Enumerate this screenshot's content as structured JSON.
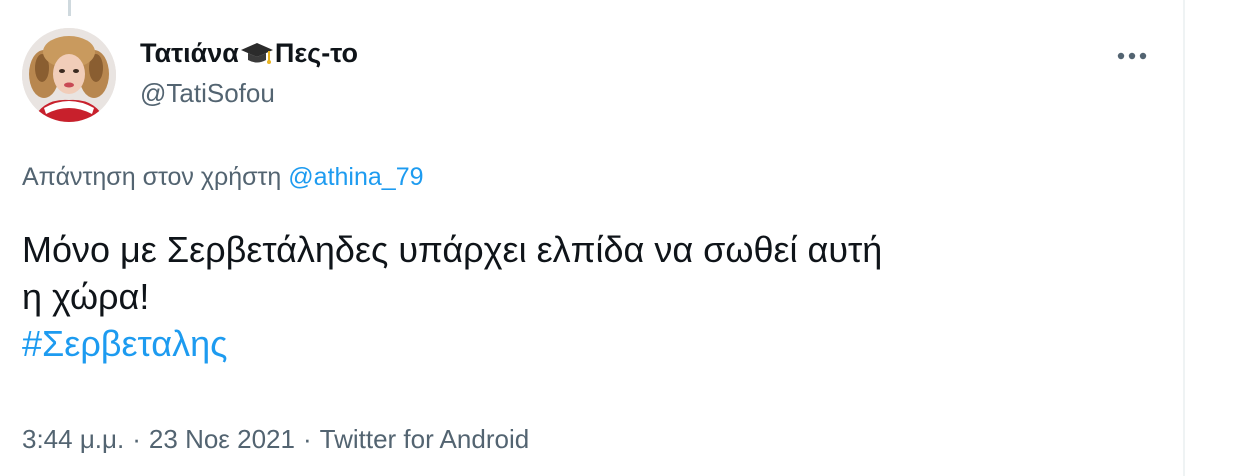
{
  "tweet": {
    "author": {
      "name_first": "Τατιάνα",
      "name_icon": "graduation-cap-emoji",
      "name_second": "Πες-το",
      "handle": "@TatiSofou",
      "avatar": "profile-photo"
    },
    "more_icon": "ellipsis-icon",
    "reply": {
      "prefix": "Απάντηση στον χρήστη",
      "mention": "@athina_79"
    },
    "text_line1": "Μόνο με Σερβετάληδες υπάρχει ελπίδα να σωθεί αυτή",
    "text_line2": "η χώρα!",
    "hashtag": "#Σερβεταλης",
    "time": "3:44 μ.μ.",
    "separator": "·",
    "date": "23 Νοε 2021",
    "source": "Twitter for Android"
  },
  "colors": {
    "accent": "#1d9bf0",
    "text_primary": "#0f1419",
    "text_secondary": "#536471",
    "divider": "#eff3f4"
  }
}
